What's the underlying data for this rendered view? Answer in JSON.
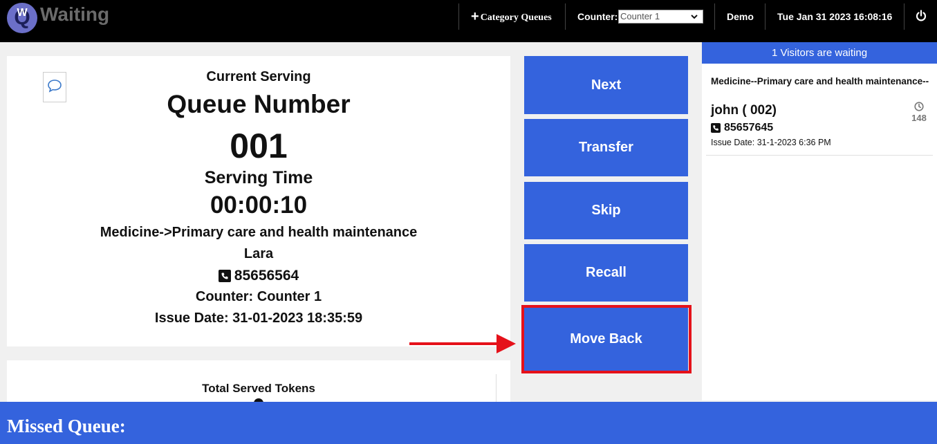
{
  "app": {
    "title": "Waiting",
    "logo_letter": "Q",
    "logo_small": "W"
  },
  "topbar": {
    "category_queues": "Category Queues",
    "counter_label": "Counter:",
    "counter_selected": "Counter 1",
    "user": "Demo",
    "datetime": "Tue Jan 31 2023 16:08:16"
  },
  "serving": {
    "current_serving": "Current Serving",
    "queue_number_label": "Queue Number",
    "queue_number": "001",
    "serving_time_label": "Serving Time",
    "serving_time": "00:00:10",
    "category": "Medicine->Primary care and health maintenance",
    "customer_name": "Lara",
    "phone": "85656564",
    "counter_line": "Counter: Counter 1",
    "issue_date_line": "Issue Date: 31-01-2023 18:35:59"
  },
  "served": {
    "title": "Total Served Tokens"
  },
  "actions": {
    "next": "Next",
    "transfer": "Transfer",
    "skip": "Skip",
    "recall": "Recall",
    "move_back": "Move Back"
  },
  "waiting": {
    "header": "1 Visitors are waiting",
    "items": [
      {
        "category": "Medicine--Primary care and health maintenance--",
        "name": "john ( 002)",
        "phone": "85657645",
        "issue_date": "Issue Date: 31-1-2023 6:36 PM",
        "wait_minutes": "148"
      }
    ]
  },
  "missed": {
    "title": "Missed Queue:"
  },
  "colors": {
    "accent": "#3463dd",
    "highlight": "#e5111a",
    "topbar": "#000000"
  },
  "icons": [
    "plus-icon",
    "chevron-down-icon",
    "power-icon",
    "chat-icon",
    "phone-icon",
    "clock-icon"
  ]
}
